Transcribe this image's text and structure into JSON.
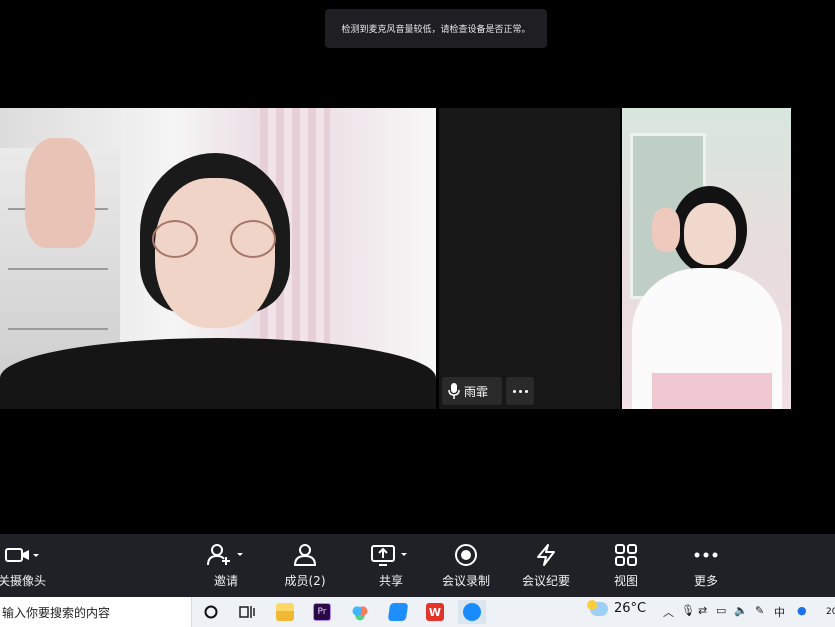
{
  "toast": {
    "message": "检测到麦克风音量较低，请检查设备是否正常。"
  },
  "participant": {
    "name": "雨霏"
  },
  "toolbar": {
    "camera": "关摄像头",
    "invite": "邀请",
    "members": "成员(2)",
    "share": "共享",
    "record": "会议录制",
    "minutes": "会议纪要",
    "view": "视图",
    "more": "更多"
  },
  "taskbar": {
    "search_placeholder": "输入你要搜索的内容",
    "temperature": "26°C",
    "ime": "中",
    "clock_fragment": "20"
  },
  "colors": {
    "toolbar_bg": "#202126",
    "stage_bg": "#000000",
    "taskbar_bg": "#eef1f5"
  }
}
